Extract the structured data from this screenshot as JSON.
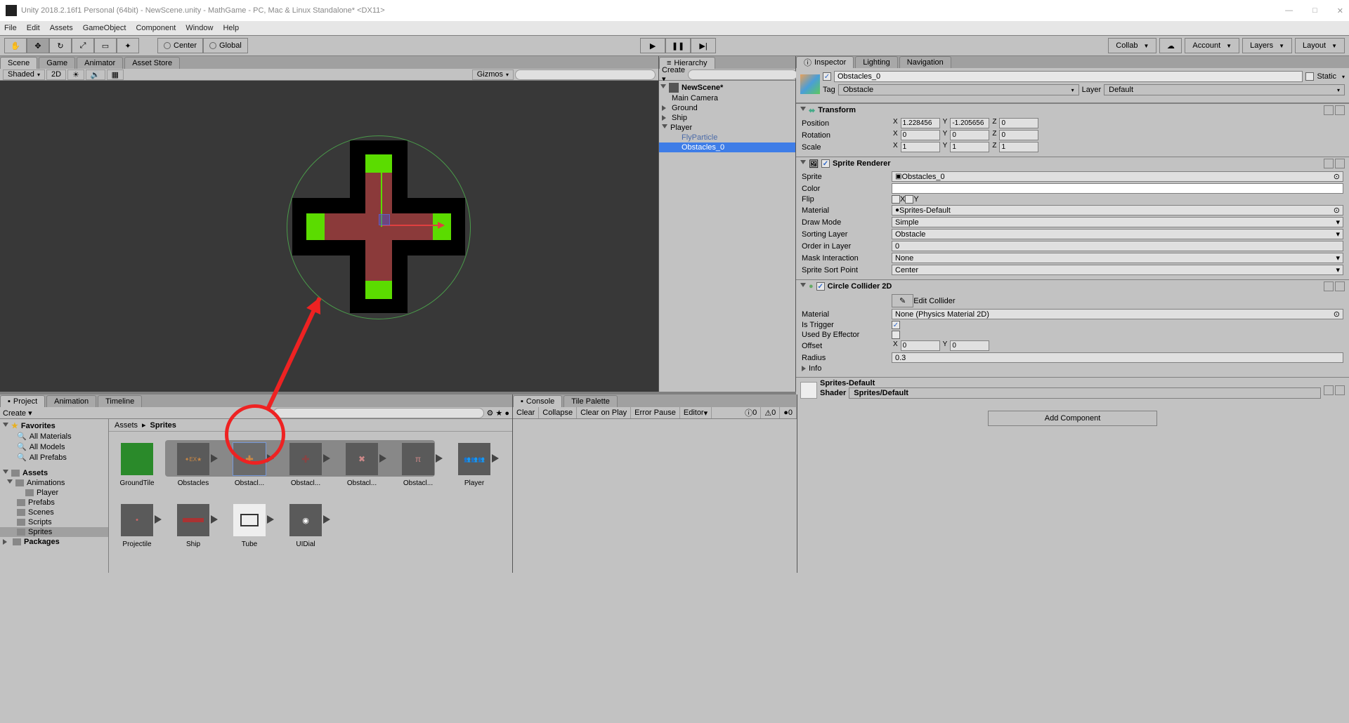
{
  "titlebar": {
    "text": "Unity 2018.2.16f1 Personal (64bit) - NewScene.unity - MathGame - PC, Mac & Linux Standalone* <DX11>"
  },
  "menubar": [
    "File",
    "Edit",
    "Assets",
    "GameObject",
    "Component",
    "Window",
    "Help"
  ],
  "toolbar": {
    "pivot": "Center",
    "handle": "Global",
    "collab": "Collab",
    "account": "Account",
    "layers": "Layers",
    "layout": "Layout"
  },
  "scene_tabs": {
    "scene": "Scene",
    "game": "Game",
    "animator": "Animator",
    "asset_store": "Asset Store"
  },
  "scene_toolbar": {
    "shading": "Shaded",
    "mode": "2D",
    "gizmos": "Gizmos"
  },
  "hierarchy": {
    "tab": "Hierarchy",
    "create": "Create",
    "scene_name": "NewScene*",
    "items": [
      "Main Camera",
      "Ground",
      "Ship",
      "Player"
    ],
    "player_children": [
      "FlyParticle",
      "Obstacles_0"
    ]
  },
  "inspector": {
    "tabs": {
      "inspector": "Inspector",
      "lighting": "Lighting",
      "navigation": "Navigation"
    },
    "object_name": "Obstacles_0",
    "static": "Static",
    "tag_label": "Tag",
    "tag_value": "Obstacle",
    "layer_label": "Layer",
    "layer_value": "Default",
    "transform": {
      "title": "Transform",
      "position": {
        "label": "Position",
        "x": "1.228456",
        "y": "-1.205656",
        "z": "0"
      },
      "rotation": {
        "label": "Rotation",
        "x": "0",
        "y": "0",
        "z": "0"
      },
      "scale": {
        "label": "Scale",
        "x": "1",
        "y": "1",
        "z": "1"
      }
    },
    "sprite_renderer": {
      "title": "Sprite Renderer",
      "sprite_label": "Sprite",
      "sprite_value": "Obstacles_0",
      "color_label": "Color",
      "flip_label": "Flip",
      "flip_x": "X",
      "flip_y": "Y",
      "material_label": "Material",
      "material_value": "Sprites-Default",
      "draw_mode_label": "Draw Mode",
      "draw_mode_value": "Simple",
      "sorting_layer_label": "Sorting Layer",
      "sorting_layer_value": "Obstacle",
      "order_label": "Order in Layer",
      "order_value": "0",
      "mask_label": "Mask Interaction",
      "mask_value": "None",
      "sort_point_label": "Sprite Sort Point",
      "sort_point_value": "Center"
    },
    "circle_collider": {
      "title": "Circle Collider 2D",
      "edit_collider": "Edit Collider",
      "material_label": "Material",
      "material_value": "None (Physics Material 2D)",
      "is_trigger_label": "Is Trigger",
      "used_by_effector_label": "Used By Effector",
      "offset_label": "Offset",
      "offset_x": "0",
      "offset_y": "0",
      "radius_label": "Radius",
      "radius_value": "0.3"
    },
    "info": "Info",
    "material_footer": {
      "name": "Sprites-Default",
      "shader_label": "Shader",
      "shader_value": "Sprites/Default"
    },
    "add_component": "Add Component"
  },
  "project": {
    "tabs": {
      "project": "Project",
      "animation": "Animation",
      "timeline": "Timeline"
    },
    "create": "Create",
    "favorites": {
      "label": "Favorites",
      "items": [
        "All Materials",
        "All Models",
        "All Prefabs"
      ]
    },
    "assets": {
      "label": "Assets",
      "folders": [
        "Animations",
        "Prefabs",
        "Scenes",
        "Scripts",
        "Sprites"
      ],
      "anim_child": "Player"
    },
    "packages": "Packages",
    "breadcrumb": {
      "root": "Assets",
      "current": "Sprites"
    },
    "grid": [
      "GroundTile",
      "Obstacles",
      "Obstacl...",
      "Obstacl...",
      "Obstacl...",
      "Obstacl...",
      "Player",
      "Projectile",
      "Ship",
      "Tube",
      "UIDial"
    ]
  },
  "console": {
    "tabs": {
      "console": "Console",
      "tile_palette": "Tile Palette"
    },
    "buttons": [
      "Clear",
      "Collapse",
      "Clear on Play",
      "Error Pause",
      "Editor"
    ],
    "counts": [
      "0",
      "0",
      "0"
    ]
  }
}
